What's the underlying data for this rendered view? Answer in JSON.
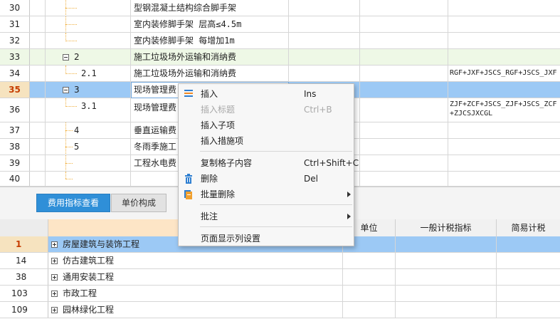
{
  "top_grid": {
    "rows": [
      {
        "num": "30",
        "code": "",
        "name": "型钢混凝土结构综合脚手架",
        "formula": ""
      },
      {
        "num": "31",
        "code": "",
        "name": "室内装修脚手架 层高≤4.5m",
        "formula": ""
      },
      {
        "num": "32",
        "code": "",
        "name": "室内装修脚手架 每增加1m",
        "formula": ""
      },
      {
        "num": "33",
        "code": "2",
        "name": "施工垃圾场外运输和消纳费",
        "formula": ""
      },
      {
        "num": "34",
        "code": "2.1",
        "name": "施工垃圾场外运输和消纳费",
        "formula": "RGF+JXF+JSCS_RGF+JSCS_JXF"
      },
      {
        "num": "35",
        "code": "3",
        "name": "现场管理费",
        "formula": ""
      },
      {
        "num": "36",
        "code": "3.1",
        "name": "现场管理费",
        "formula": "ZJF+ZCF+JSCS_ZJF+JSCS_ZCF",
        "formula2": "+ZJCSJXCGL"
      },
      {
        "num": "37",
        "code": "4",
        "name": "垂直运输费",
        "formula": ""
      },
      {
        "num": "38",
        "code": "5",
        "name": "冬雨季施工",
        "formula": ""
      },
      {
        "num": "39",
        "code": "",
        "name": "工程水电费",
        "formula": ""
      },
      {
        "num": "40",
        "code": "",
        "name": "",
        "formula": ""
      }
    ]
  },
  "tabs": {
    "fee_index": "费用指标查看",
    "unit_composition": "单价构成"
  },
  "bottom_grid": {
    "headers": {
      "unit": "单位",
      "general_tax": "一般计税指标",
      "simple_tax": "简易计税"
    },
    "rows": [
      {
        "num": "1",
        "name": "房屋建筑与装饰工程"
      },
      {
        "num": "14",
        "name": "仿古建筑工程"
      },
      {
        "num": "38",
        "name": "通用安装工程"
      },
      {
        "num": "103",
        "name": "市政工程"
      },
      {
        "num": "109",
        "name": "园林绿化工程"
      }
    ]
  },
  "context_menu": {
    "insert": {
      "label": "插入",
      "shortcut": "Ins"
    },
    "insert_title": {
      "label": "插入标题",
      "shortcut": "Ctrl+B"
    },
    "insert_child": {
      "label": "插入子项"
    },
    "insert_measure": {
      "label": "插入措施项"
    },
    "copy_cell": {
      "label": "复制格子内容",
      "shortcut": "Ctrl+Shift+C"
    },
    "delete": {
      "label": "删除",
      "shortcut": "Del"
    },
    "batch_delete": {
      "label": "批量删除"
    },
    "annotate": {
      "label": "批注"
    },
    "page_columns": {
      "label": "页面显示列设置"
    }
  },
  "colors": {
    "selected_row": "#9cc9f5",
    "group_row": "#eef8e6",
    "active_tab": "#2f8fd8",
    "row_number_highlight": "#c53c00"
  },
  "icons": [
    "insert-icon",
    "delete-icon",
    "batch-delete-icon",
    "submenu-arrow-icon",
    "expand-toggle-icon",
    "collapse-toggle-icon"
  ]
}
